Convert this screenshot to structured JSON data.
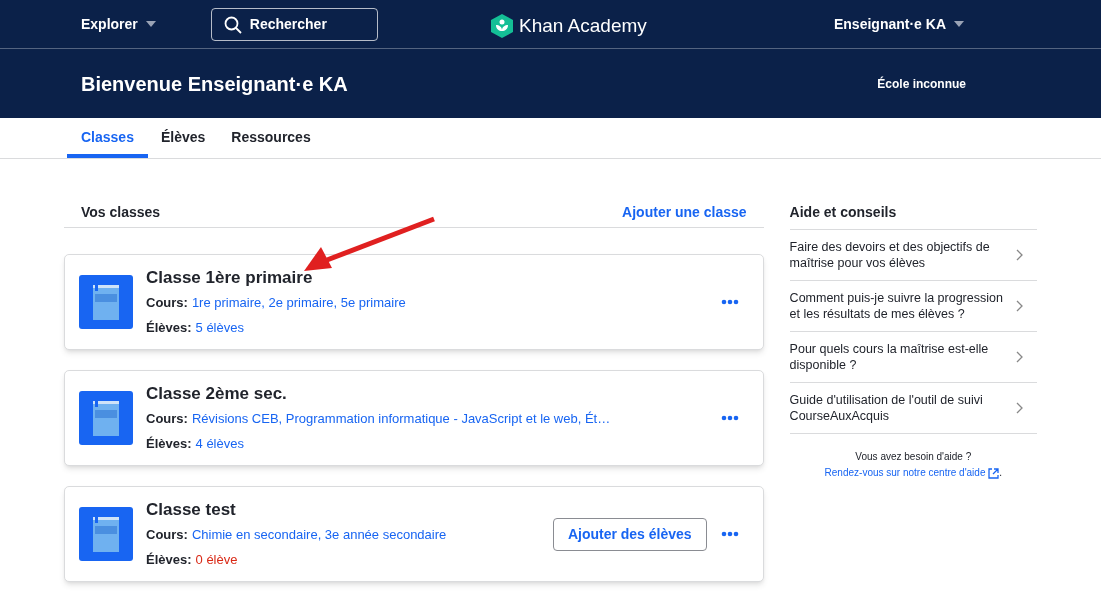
{
  "nav": {
    "explore": "Explorer",
    "search": {
      "placeholder": "Rechercher"
    },
    "logo": "Khan Academy",
    "user": "Enseignant·e KA"
  },
  "header": {
    "title": "Bienvenue Enseignant·e KA",
    "school": "École inconnue"
  },
  "tabs": [
    {
      "label": "Classes",
      "selected": true
    },
    {
      "label": "Élèves",
      "selected": false
    },
    {
      "label": "Ressources",
      "selected": false
    }
  ],
  "classes_section": {
    "title": "Vos classes",
    "add_link": "Ajouter une classe"
  },
  "classes": [
    {
      "name": "Classe 1ère primaire",
      "courses_label": "Cours:",
      "courses": "1re primaire, 2e primaire, 5e primaire",
      "students_label": "Élèves:",
      "students": "5 élèves",
      "no_students": false
    },
    {
      "name": "Classe 2ème sec.",
      "courses_label": "Cours:",
      "courses": "Révisions CEB, Programmation informatique - JavaScript et le web, Ét…",
      "students_label": "Élèves:",
      "students": "4 élèves",
      "no_students": false
    },
    {
      "name": "Classe test",
      "courses_label": "Cours:",
      "courses": "Chimie en secondaire, 3e année secondaire",
      "students_label": "Élèves:",
      "students": "0 élève",
      "no_students": true,
      "add_button": "Ajouter des élèves"
    }
  ],
  "help": {
    "title": "Aide et conseils",
    "items": [
      "Faire des devoirs et des objectifs de maîtrise pour vos élèves",
      "Comment puis-je suivre la progression et les résultats de mes élèves ?",
      "Pour quels cours la maîtrise est-elle disponible ?",
      "Guide d'utilisation de l'outil de suivi CourseAuxAcquis"
    ],
    "footer_text": "Vous avez besoin d'aide ?",
    "footer_link": "Rendez-vous sur notre centre d'aide",
    "footer_end": "."
  }
}
